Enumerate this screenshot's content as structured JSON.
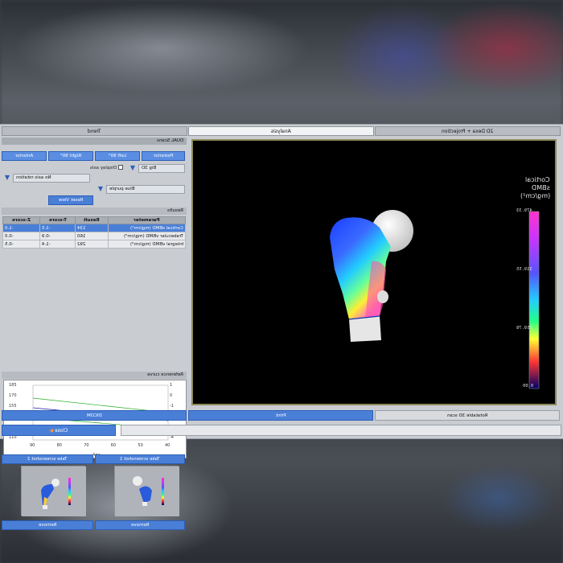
{
  "tabs": [
    {
      "label": "Trend",
      "active": false
    },
    {
      "label": "Analysis",
      "active": true
    },
    {
      "label": "2D Dexa + Projection",
      "active": false
    }
  ],
  "section_title": "DUAL Scans",
  "view_buttons": [
    "Anterior",
    "Right 90°",
    "Left 90°",
    "Posterior"
  ],
  "view_controls": {
    "size": "Big 3D",
    "display_axis": "Display axis",
    "rotation": "No axis rotation",
    "palette": "Blue purple",
    "reset": "Reset View"
  },
  "results": {
    "title": "Results",
    "columns": [
      "Parameter",
      "Result",
      "T-score",
      "Z-score"
    ],
    "rows": [
      {
        "parameter": "Cortical sBMD (mg/cm²)",
        "result": "134",
        "tscore": "-1.5",
        "zscore": "-1.0",
        "selected": true
      },
      {
        "parameter": "Trabecular vBMD (mg/cm³)",
        "result": "160",
        "tscore": "-0.9",
        "zscore": "-0.0",
        "selected": false
      },
      {
        "parameter": "Integral vBMD (mg/cm³)",
        "result": "292",
        "tscore": "-1.4",
        "zscore": "-0.5",
        "selected": false
      }
    ]
  },
  "reference_curve": {
    "title": "Reference curve",
    "xlabel": "Age",
    "x_ticks": [
      "40",
      "50",
      "60",
      "70",
      "80",
      "90"
    ],
    "y_ticks_left": [
      "-4",
      "-3",
      "-2",
      "-1",
      "0",
      "1"
    ],
    "y_ticks_right": [
      "110",
      "125",
      "140",
      "155",
      "170",
      "185"
    ]
  },
  "screenshots": [
    {
      "take_label": "Take screenshot 2",
      "remove_label": "Remove"
    },
    {
      "take_label": "Take screenshot 1",
      "remove_label": "Remove"
    }
  ],
  "colorbar": {
    "title_line1": "Cortical",
    "title_line2": "sBMD",
    "title_line3": "(mg/cm²)",
    "ticks": [
      "479.33",
      "319.55",
      "159.78",
      "0.00"
    ],
    "colors": [
      "#ff33cc",
      "#cc33ff",
      "#5555ff",
      "#22ccff",
      "#22ff88",
      "#ffff33",
      "#ff8833",
      "#ff3333",
      "#000066"
    ]
  },
  "bottom_bar": {
    "dicom": "DICOM",
    "print": "Print",
    "rotatable": "Rotatable 3D scan"
  },
  "close_label": "Close"
}
